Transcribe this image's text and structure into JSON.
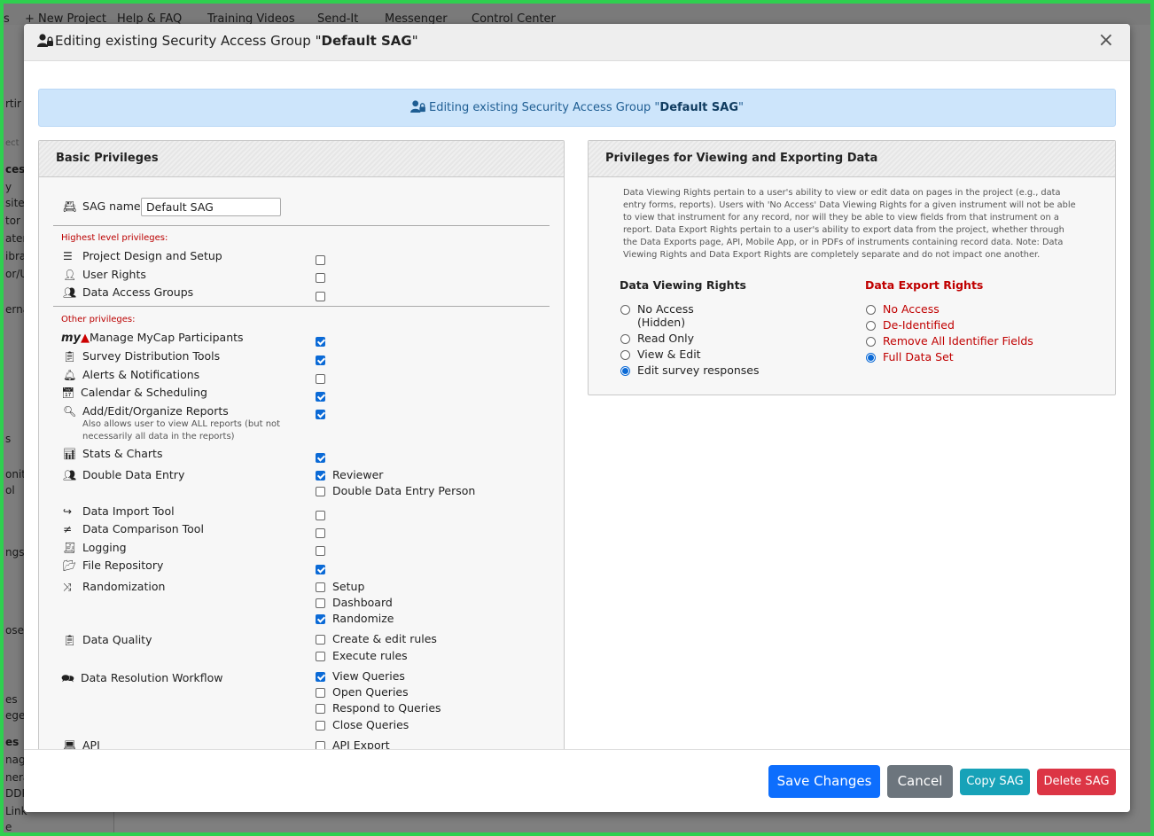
{
  "background_nav": {
    "items": [
      "s",
      "+ New Project",
      "Help & FAQ",
      "Training Videos",
      "Send-It",
      "Messenger",
      "Control Center"
    ]
  },
  "background_side": [
    "rtir",
    "ect",
    "ces",
    "y",
    "site",
    "tor",
    "ater",
    "ibra",
    "or/U",
    "erna",
    "s",
    "onit",
    "ol",
    "ngs",
    "osed",
    "es",
    "eges",
    "es",
    "nag",
    "nera",
    "DDP",
    "Link",
    "e"
  ],
  "modal": {
    "title_prefix": "Editing existing Security Access Group \"",
    "title_name": "Default SAG",
    "title_suffix": "\"",
    "close_symbol": "×"
  },
  "alert": {
    "prefix": "Editing existing Security Access Group \"",
    "name": "Default SAG",
    "suffix": "\""
  },
  "basic": {
    "heading": "Basic Privileges",
    "sag_label": "SAG name:",
    "sag_value": "Default SAG",
    "highest_label": "Highest level privileges:",
    "other_label": "Other privileges:",
    "highest": [
      {
        "label": "Project Design and Setup",
        "checked": false
      },
      {
        "label": "User Rights",
        "checked": false
      },
      {
        "label": "Data Access Groups",
        "checked": false
      }
    ],
    "other": [
      {
        "label": "Manage MyCap Participants",
        "checked": true
      },
      {
        "label": "Survey Distribution Tools",
        "checked": true
      },
      {
        "label": "Alerts & Notifications",
        "checked": false
      },
      {
        "label": "Calendar & Scheduling",
        "checked": true
      },
      {
        "label": "Add/Edit/Organize Reports",
        "checked": true,
        "note": "Also allows user to view ALL reports (but not necessarily all data in the reports)"
      },
      {
        "label": "Stats & Charts",
        "checked": true
      },
      {
        "label": "Double Data Entry",
        "options": [
          {
            "label": "Reviewer",
            "checked": true
          },
          {
            "label": "Double Data Entry Person",
            "checked": false
          }
        ]
      },
      {
        "label": "Data Import Tool",
        "checked": false
      },
      {
        "label": "Data Comparison Tool",
        "checked": false
      },
      {
        "label": "Logging",
        "checked": false
      },
      {
        "label": "File Repository",
        "checked": true
      },
      {
        "label": "Randomization",
        "options": [
          {
            "label": "Setup",
            "checked": false
          },
          {
            "label": "Dashboard",
            "checked": false
          },
          {
            "label": "Randomize",
            "checked": true
          }
        ]
      },
      {
        "label": "Data Quality",
        "options": [
          {
            "label": "Create & edit rules",
            "checked": false
          },
          {
            "label": "Execute rules",
            "checked": false
          }
        ]
      },
      {
        "label": "Data Resolution Workflow",
        "options": [
          {
            "label": "View Queries",
            "checked": true
          },
          {
            "label": "Open Queries",
            "checked": false
          },
          {
            "label": "Respond to Queries",
            "checked": false
          },
          {
            "label": "Close Queries",
            "checked": false
          }
        ]
      },
      {
        "label": "API",
        "options": [
          {
            "label": "API Export",
            "checked": false
          }
        ]
      }
    ],
    "mycap_logo": "my"
  },
  "viewing": {
    "heading": "Privileges for Viewing and Exporting Data",
    "description": "Data Viewing Rights pertain to a user's ability to view or edit data on pages in the project (e.g., data entry forms, reports). Users with 'No Access' Data Viewing Rights for a given instrument will not be able to view that instrument for any record, nor will they be able to view fields from that instrument on a report. Data Export Rights pertain to a user's ability to export data from the project, whether through the Data Exports page, API, Mobile App, or in PDFs of instruments containing record data. Note: Data Viewing Rights and Data Export Rights are completely separate and do not impact one another.",
    "viewing_heading": "Data Viewing Rights",
    "export_heading": "Data Export Rights",
    "viewing_options": [
      {
        "label": "No Access",
        "sub": "(Hidden)",
        "selected": false
      },
      {
        "label": "Read Only",
        "selected": false
      },
      {
        "label": "View & Edit",
        "selected": false
      },
      {
        "label": "Edit survey responses",
        "selected": true
      }
    ],
    "export_options": [
      {
        "label": "No Access",
        "selected": false
      },
      {
        "label": "De-Identified",
        "selected": false
      },
      {
        "label": "Remove All Identifier Fields",
        "selected": false
      },
      {
        "label": "Full Data Set",
        "selected": true
      }
    ]
  },
  "footer": {
    "save": "Save Changes",
    "cancel": "Cancel",
    "copy": "Copy SAG",
    "delete": "Delete SAG"
  },
  "colors": {
    "primary": "#0d6efd",
    "secondary": "#6c757d",
    "info": "#17a2b8",
    "danger": "#dc3545",
    "alert_bg": "#cde5fb",
    "frame": "#2fcf4f"
  }
}
